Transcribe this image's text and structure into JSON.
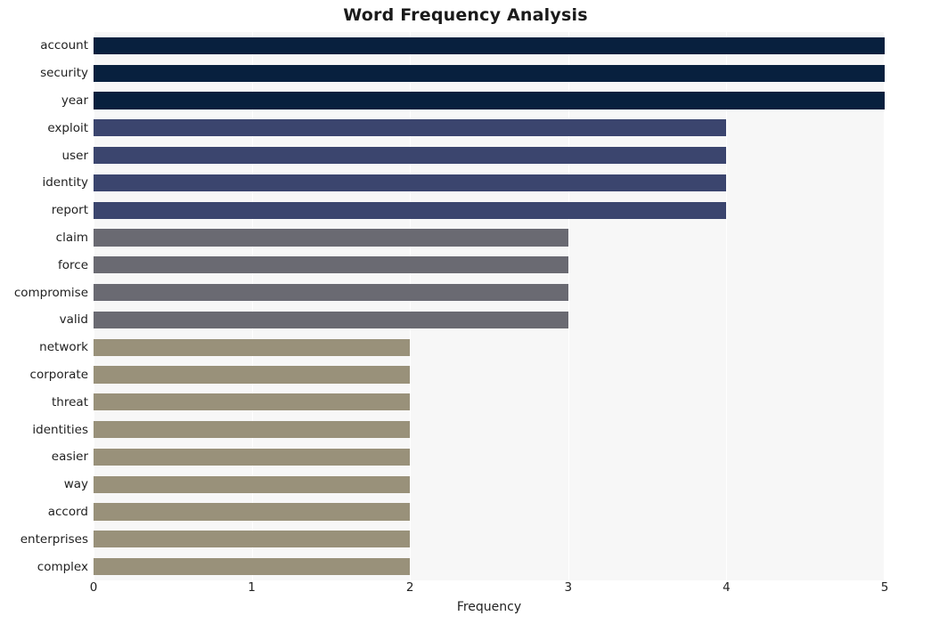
{
  "chart_data": {
    "type": "bar",
    "orientation": "horizontal",
    "title": "Word Frequency Analysis",
    "xlabel": "Frequency",
    "ylabel": "",
    "xlim": [
      0,
      5
    ],
    "xticks": [
      0,
      1,
      2,
      3,
      4,
      5
    ],
    "xtick_labels": [
      "0",
      "1",
      "2",
      "3",
      "4",
      "5"
    ],
    "grid": true,
    "grid_axis": "x",
    "legend": null,
    "plot_background": "#f7f7f7",
    "figure_background": "#ffffff",
    "categories": [
      "account",
      "security",
      "year",
      "exploit",
      "user",
      "identity",
      "report",
      "claim",
      "force",
      "compromise",
      "valid",
      "network",
      "corporate",
      "threat",
      "identities",
      "easier",
      "way",
      "accord",
      "enterprises",
      "complex"
    ],
    "values": [
      5,
      5,
      5,
      4,
      4,
      4,
      4,
      3,
      3,
      3,
      3,
      2,
      2,
      2,
      2,
      2,
      2,
      2,
      2,
      2
    ],
    "bar_colors": [
      "#08203e",
      "#08203e",
      "#08203e",
      "#3b456e",
      "#3b456e",
      "#3b456e",
      "#3b456e",
      "#6a6a72",
      "#6a6a72",
      "#6a6a72",
      "#6a6a72",
      "#99917a",
      "#99917a",
      "#99917a",
      "#99917a",
      "#99917a",
      "#99917a",
      "#99917a",
      "#99917a",
      "#99917a"
    ]
  }
}
